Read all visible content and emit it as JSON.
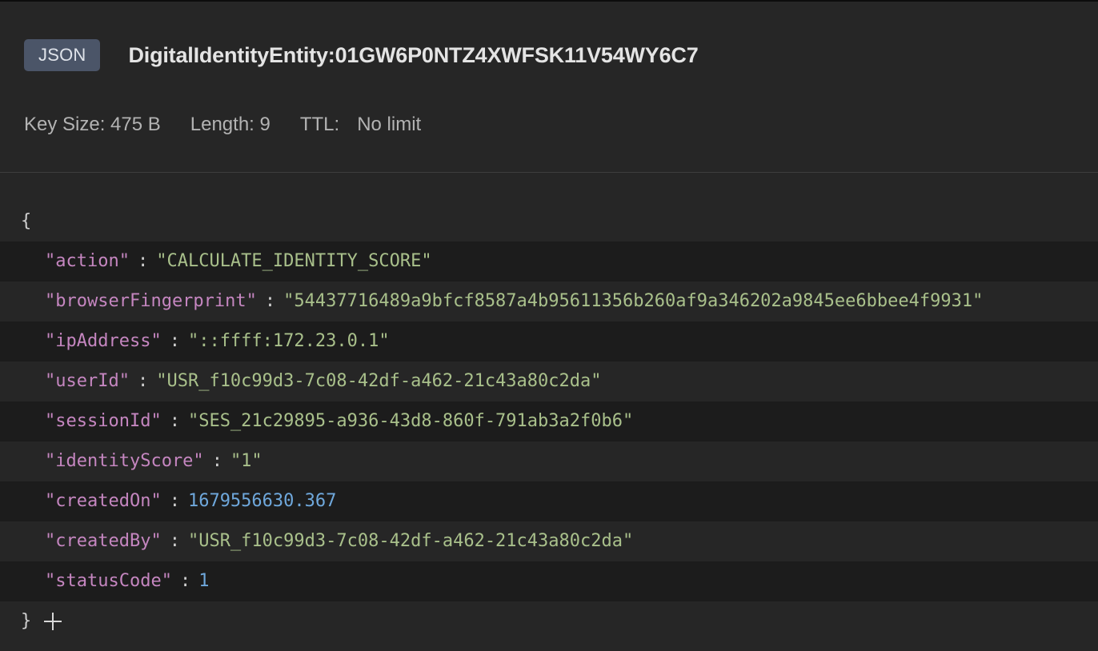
{
  "header": {
    "type_badge": "JSON",
    "key_name": "DigitalIdentityEntity:01GW6P0NTZ4XWFSK11V54WY6C7",
    "key_size": "Key Size: 475 B",
    "length": "Length: 9",
    "ttl_label": "TTL:",
    "ttl_value": "No limit"
  },
  "json": {
    "open_brace": "{",
    "close_brace": "}",
    "colon": ":",
    "rows": [
      {
        "key": "\"action\"",
        "value": "\"CALCULATE_IDENTITY_SCORE\"",
        "kind": "string"
      },
      {
        "key": "\"browserFingerprint\"",
        "value": "\"54437716489a9bfcf8587a4b95611356b260af9a346202a9845ee6bbee4f9931\"",
        "kind": "string"
      },
      {
        "key": "\"ipAddress\"",
        "value": "\"::ffff:172.23.0.1\"",
        "kind": "string"
      },
      {
        "key": "\"userId\"",
        "value": "\"USR_f10c99d3-7c08-42df-a462-21c43a80c2da\"",
        "kind": "string"
      },
      {
        "key": "\"sessionId\"",
        "value": "\"SES_21c29895-a936-43d8-860f-791ab3a2f0b6\"",
        "kind": "string"
      },
      {
        "key": "\"identityScore\"",
        "value": "\"1\"",
        "kind": "string"
      },
      {
        "key": "\"createdOn\"",
        "value": "1679556630.367",
        "kind": "number"
      },
      {
        "key": "\"createdBy\"",
        "value": "\"USR_f10c99d3-7c08-42df-a462-21c43a80c2da\"",
        "kind": "string"
      },
      {
        "key": "\"statusCode\"",
        "value": "1",
        "kind": "number"
      }
    ]
  },
  "icons": {
    "add": "plus-icon"
  }
}
